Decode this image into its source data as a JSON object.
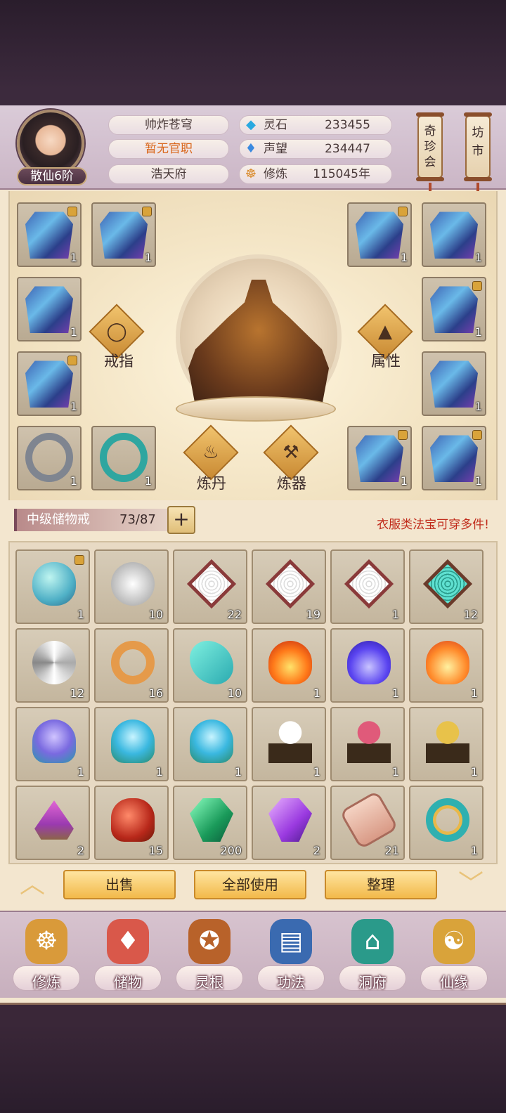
{
  "player": {
    "name": "帅炸苍穹",
    "official_post": "暂无官职",
    "residence": "浩天府",
    "rank": "散仙6阶"
  },
  "stats": [
    {
      "icon": "spirit-stone-icon",
      "label": "灵石",
      "value": "233455"
    },
    {
      "icon": "reputation-icon",
      "label": "声望",
      "value": "234447"
    },
    {
      "icon": "cultivation-icon",
      "label": "修炼",
      "value": "115045年"
    }
  ],
  "header_buttons": {
    "treasure": "奇珍会",
    "market": "坊市"
  },
  "equipment": {
    "slots": [
      {
        "type": "robe",
        "count": "1",
        "locked": true
      },
      {
        "type": "robe",
        "count": "1",
        "locked": true
      },
      {
        "type": "robe",
        "count": "1",
        "locked": true
      },
      {
        "type": "robe",
        "count": "1",
        "locked": false
      },
      {
        "type": "robe",
        "count": "1",
        "locked": false
      },
      {
        "type": "robe",
        "count": "1",
        "locked": true
      },
      {
        "type": "robe",
        "count": "1",
        "locked": true
      },
      {
        "type": "robe",
        "count": "1",
        "locked": false
      },
      {
        "type": "ring",
        "count": "1",
        "locked": false
      },
      {
        "type": "ring",
        "count": "1",
        "locked": false
      },
      {
        "type": "robe",
        "count": "1",
        "locked": true
      },
      {
        "type": "robe",
        "count": "1",
        "locked": true
      }
    ],
    "actions": {
      "ring": "戒指",
      "attributes": "属性",
      "alchemy": "炼丹",
      "forging": "炼器"
    }
  },
  "storage": {
    "name": "中级储物戒",
    "capacity": "73/87",
    "add": "+",
    "note": "衣服类法宝可穿多件!"
  },
  "inventory": [
    {
      "art": "a-egg",
      "count": "1",
      "locked": true
    },
    {
      "art": "a-orb",
      "count": "10"
    },
    {
      "art": "a-tray",
      "count": "22"
    },
    {
      "art": "a-tray",
      "count": "19"
    },
    {
      "art": "a-tray",
      "count": "1"
    },
    {
      "art": "a-tray-teal",
      "count": "12"
    },
    {
      "art": "a-disc",
      "count": "12"
    },
    {
      "art": "a-ring",
      "count": "16"
    },
    {
      "art": "a-wind",
      "count": "10"
    },
    {
      "art": "a-fire3",
      "count": "1"
    },
    {
      "art": "a-fireblue",
      "count": "1"
    },
    {
      "art": "a-fireorange",
      "count": "1"
    },
    {
      "art": "a-water1",
      "count": "1"
    },
    {
      "art": "a-water2",
      "count": "1"
    },
    {
      "art": "a-water2",
      "count": "1"
    },
    {
      "art": "a-tree-w",
      "count": "1"
    },
    {
      "art": "a-tree-p",
      "count": "1"
    },
    {
      "art": "a-tree-g",
      "count": "1"
    },
    {
      "art": "a-powder",
      "count": "2"
    },
    {
      "art": "a-pot",
      "count": "15"
    },
    {
      "art": "a-gem-g",
      "count": "200"
    },
    {
      "art": "a-gem-p",
      "count": "2"
    },
    {
      "art": "a-scroll",
      "count": "21"
    },
    {
      "art": "a-bracelet",
      "count": "1"
    }
  ],
  "actions": {
    "sell": "出售",
    "use_all": "全部使用",
    "sort": "整理",
    "up": "︿",
    "down": "﹀"
  },
  "nav": [
    {
      "label": "修炼",
      "icon": "☸",
      "color": "#d99a3a"
    },
    {
      "label": "储物",
      "icon": "♦",
      "color": "#d9584a"
    },
    {
      "label": "灵根",
      "icon": "✪",
      "color": "#b8622a"
    },
    {
      "label": "功法",
      "icon": "▤",
      "color": "#3a6ab0"
    },
    {
      "label": "洞府",
      "icon": "⌂",
      "color": "#2a9a8a"
    },
    {
      "label": "仙缘",
      "icon": "☯",
      "color": "#d9a33a"
    }
  ]
}
